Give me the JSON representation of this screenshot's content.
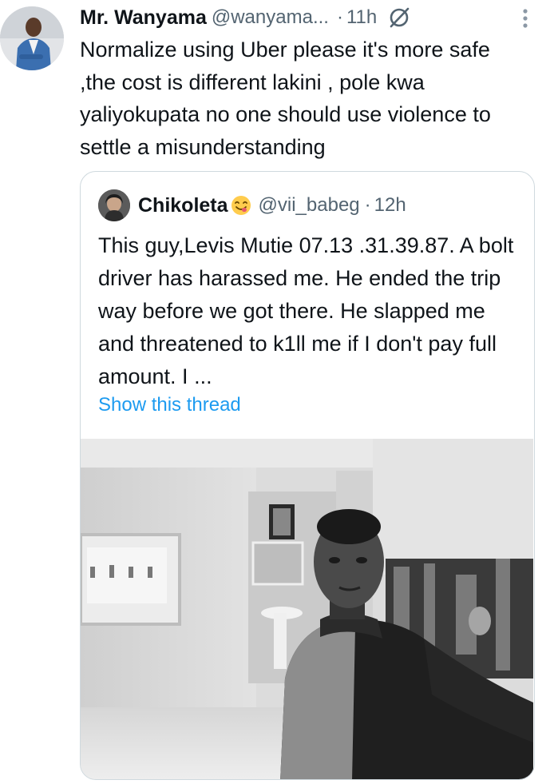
{
  "tweet": {
    "author_name": "Mr. Wanyama",
    "handle": "@wanyama...",
    "separator": "·",
    "time": "11h",
    "text": "Normalize using Uber please it's more safe ,the cost is different lakini , pole kwa yaliyokupata no one should use violence to settle a misunderstanding"
  },
  "quote": {
    "author_name": "Chikoleta",
    "emoji": "😋",
    "handle": "@vii_babeg",
    "separator": "·",
    "time": "12h",
    "text": "This guy,Levis Mutie 07.13 .31.39.87. A bolt driver has harassed me. He ended the trip way before we got there. He slapped me and threatened to k1ll me if I don't pay full amount. I ...",
    "show_thread": "Show this thread"
  },
  "icons": {
    "grok": "grok-slash-icon",
    "more": "more-vertical-icon"
  },
  "colors": {
    "link": "#1d9bf0",
    "secondary_text": "#536471",
    "border": "#cfd9de"
  }
}
